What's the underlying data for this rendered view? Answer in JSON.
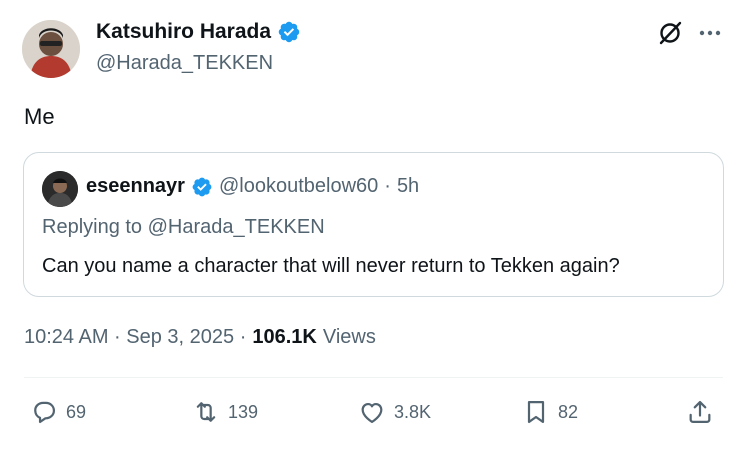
{
  "tweet": {
    "author": {
      "name": "Katsuhiro Harada",
      "handle": "@Harada_TEKKEN",
      "verified": true
    },
    "text": "Me",
    "timestamp": "10:24 AM · Sep 3, 2025 ·",
    "views": {
      "count": "106.1K",
      "label": "Views"
    }
  },
  "quote": {
    "author": {
      "name": "eseennayr",
      "handle": "@lookoutbelow60",
      "separator": "·",
      "age": "5h",
      "verified": true
    },
    "replying_to": "Replying to @Harada_TEKKEN",
    "text": "Can you name a character that will never return to Tekken again?"
  },
  "actions": {
    "reply_count": "69",
    "retweet_count": "139",
    "like_count": "3.8K",
    "bookmark_count": "82"
  },
  "colors": {
    "verified_blue": "#1d9bf0",
    "secondary_text": "#536471",
    "primary_text": "#0f1419",
    "border": "#cfd9de"
  },
  "icons": [
    "grok-icon",
    "more-icon",
    "verified-icon",
    "reply-icon",
    "retweet-icon",
    "like-icon",
    "bookmark-icon",
    "share-icon"
  ]
}
